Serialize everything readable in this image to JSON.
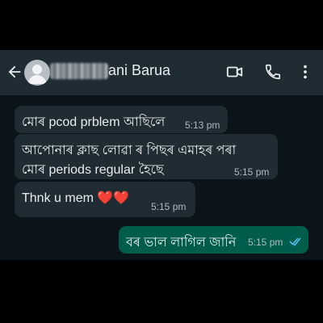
{
  "header": {
    "contact_name": "ani Barua",
    "back_icon": "arrow-left-icon",
    "video_icon": "video-call-icon",
    "call_icon": "phone-icon",
    "menu_icon": "more-vert-icon"
  },
  "messages": [
    {
      "direction": "incoming",
      "lines": [
        "মোৰ pcod prblem আছিলে"
      ],
      "time": "5:13 pm"
    },
    {
      "direction": "incoming",
      "lines": [
        "আপোনাৰ ক্লাছ লোৱা ৰ পিছৰ এমাহৰ পৰা",
        "মোৰ periods  regular হৈছে"
      ],
      "time": "5:15 pm"
    },
    {
      "direction": "incoming",
      "lines": [
        "Thnk u mem ❤️❤️"
      ],
      "time": "5:15 pm"
    },
    {
      "direction": "outgoing",
      "lines": [
        "বৰ ভাল লাগিল জানি"
      ],
      "time": "5:15 pm",
      "status": "read"
    }
  ],
  "colors": {
    "header_bg": "#1f2c34",
    "chat_bg": "#0b141a",
    "incoming_bubble": "#1f2c34",
    "outgoing_bubble": "#005c4b",
    "read_ticks": "#53bdeb"
  }
}
